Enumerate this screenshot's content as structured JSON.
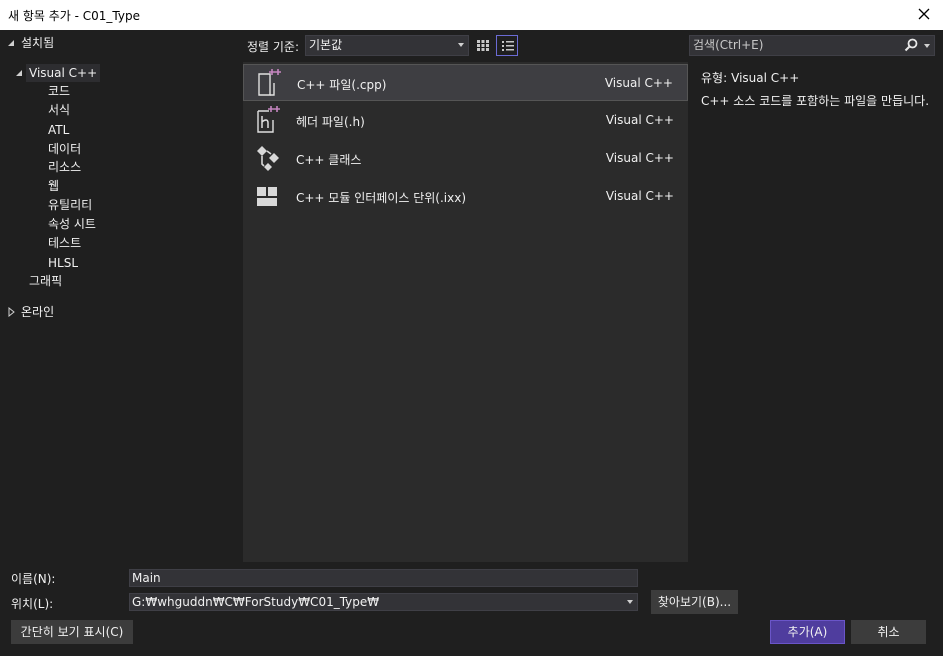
{
  "window": {
    "title": "새 항목 추가 - C01_Type"
  },
  "tree": {
    "installed": "설치됨",
    "visual_cpp": "Visual C++",
    "children": [
      "코드",
      "서식",
      "ATL",
      "데이터",
      "리소스",
      "웹",
      "유틸리티",
      "속성 시트",
      "테스트",
      "HLSL"
    ],
    "graphics": "그래픽",
    "online": "온라인"
  },
  "toolbar": {
    "sort_label": "정렬 기준:",
    "sort_value": "기본값"
  },
  "templates": [
    {
      "name": "C++ 파일(.cpp)",
      "lang": "Visual C++",
      "icon": "cpp-file-icon"
    },
    {
      "name": "헤더 파일(.h)",
      "lang": "Visual C++",
      "icon": "header-file-icon"
    },
    {
      "name": "C++ 클래스",
      "lang": "Visual C++",
      "icon": "class-icon"
    },
    {
      "name": "C++ 모듈 인터페이스 단위(.ixx)",
      "lang": "Visual C++",
      "icon": "module-icon"
    }
  ],
  "search": {
    "placeholder": "검색(Ctrl+E)"
  },
  "details": {
    "type_label": "유형:",
    "type_value": "Visual C++",
    "description": "C++ 소스 코드를 포함하는 파일을 만듭니다."
  },
  "form": {
    "name_label": "이름(N):",
    "name_value": "Main",
    "location_label": "위치(L):",
    "location_value": "G:₩whguddn₩C₩ForStudy₩C01_Type₩",
    "browse_label": "찾아보기(B)...",
    "compact_label": "간단히 보기 표시(C)",
    "add_label": "추가(A)",
    "cancel_label": "취소"
  },
  "colors": {
    "accent": "#4f3d9e",
    "icon_plus": "#c586c0",
    "background": "#1f1f1f",
    "list_bg": "#2b2b2b"
  }
}
